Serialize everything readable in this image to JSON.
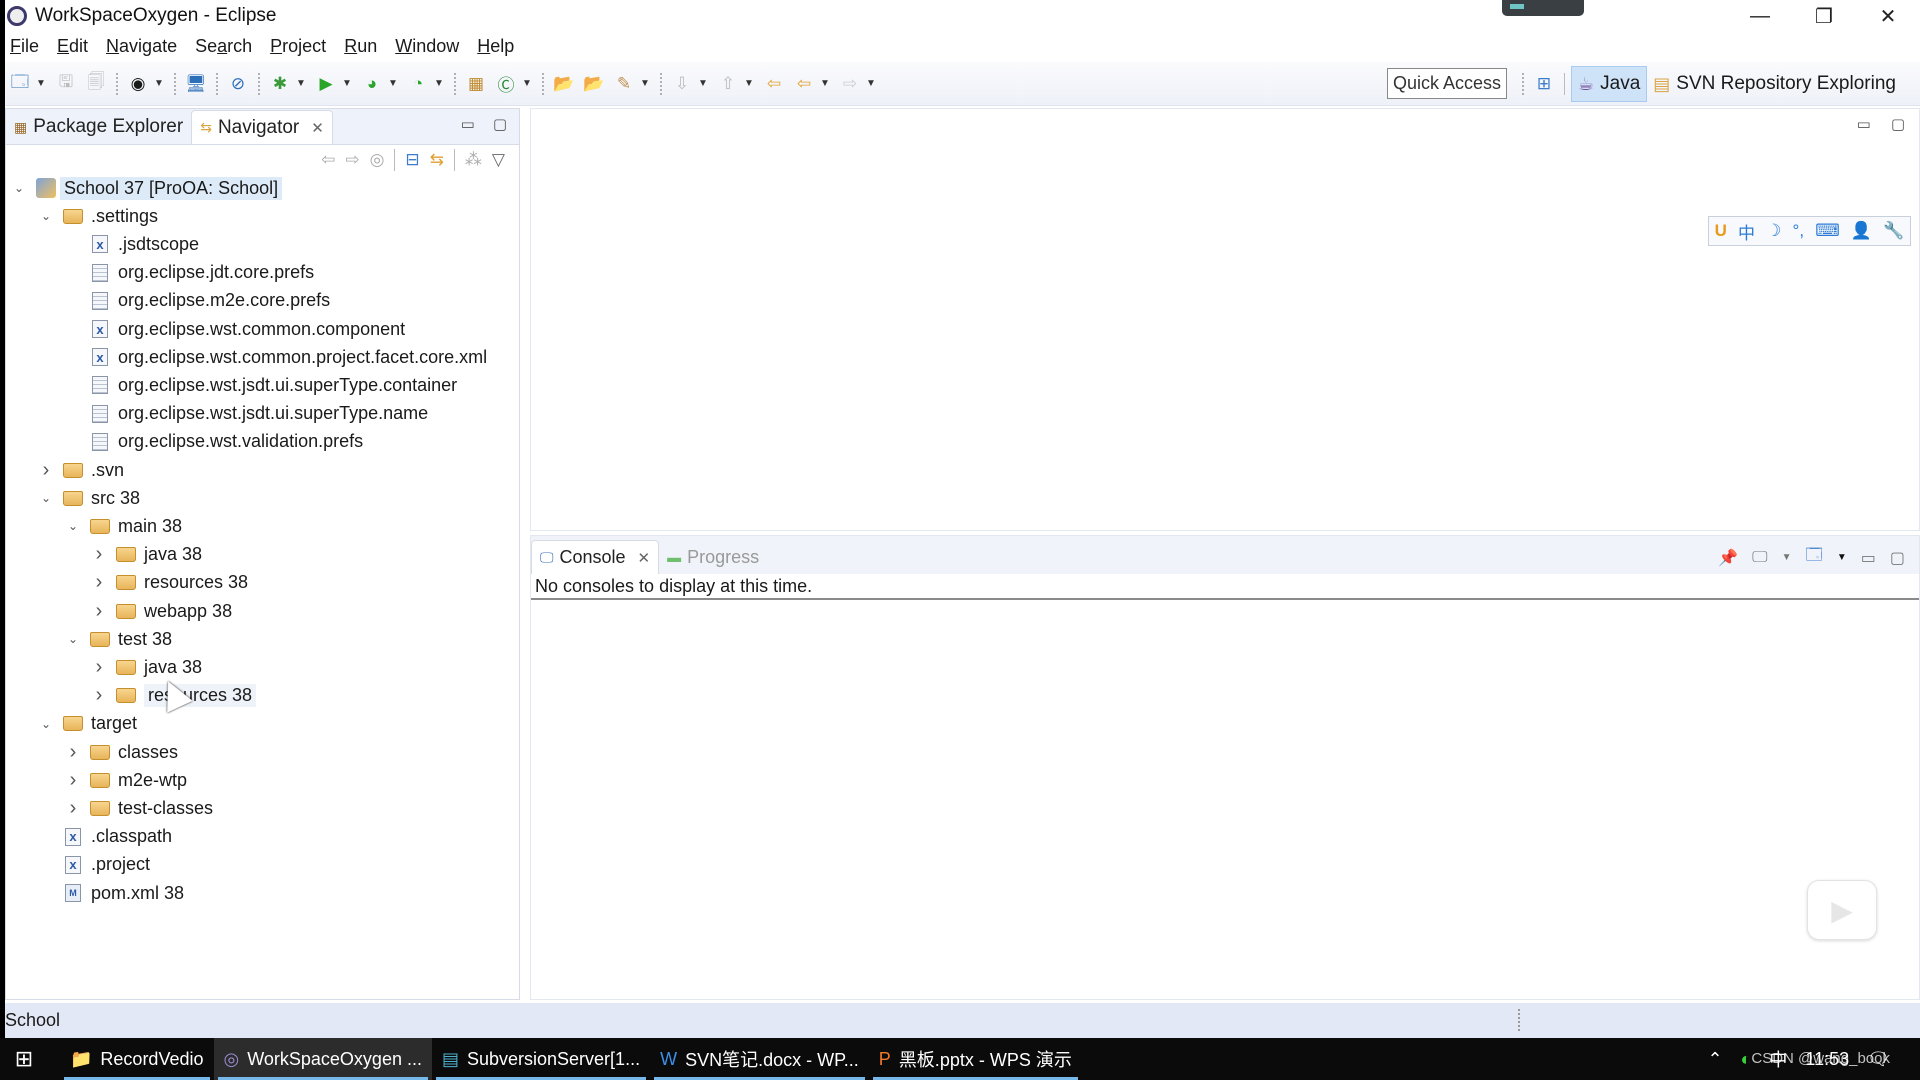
{
  "window": {
    "title": "WorkSpaceOxygen - Eclipse",
    "controls": [
      "minimize",
      "restore",
      "close"
    ]
  },
  "menu": [
    {
      "label": "File",
      "mnemonic": "F"
    },
    {
      "label": "Edit",
      "mnemonic": "E"
    },
    {
      "label": "Navigate",
      "mnemonic": "N"
    },
    {
      "label": "Search",
      "mnemonic": "a"
    },
    {
      "label": "Project",
      "mnemonic": "P"
    },
    {
      "label": "Run",
      "mnemonic": "R"
    },
    {
      "label": "Window",
      "mnemonic": "W"
    },
    {
      "label": "Help",
      "mnemonic": "H"
    }
  ],
  "toolbar": {
    "quick_access": "Quick Access",
    "perspectives": [
      {
        "label": "Java",
        "active": true
      },
      {
        "label": "SVN Repository Exploring",
        "active": false
      }
    ]
  },
  "left_panel": {
    "tabs": [
      {
        "label": "Package Explorer",
        "active": false
      },
      {
        "label": "Navigator",
        "active": true
      }
    ],
    "tree": [
      {
        "label": "School 37 [ProOA: School]",
        "depth": 0,
        "type": "project",
        "expand": "open",
        "selected": true
      },
      {
        "label": ".settings",
        "depth": 1,
        "type": "folder",
        "expand": "open"
      },
      {
        "label": ".jsdtscope",
        "depth": 2,
        "type": "xml",
        "expand": "none"
      },
      {
        "label": "org.eclipse.jdt.core.prefs",
        "depth": 2,
        "type": "txt",
        "expand": "none"
      },
      {
        "label": "org.eclipse.m2e.core.prefs",
        "depth": 2,
        "type": "txt",
        "expand": "none"
      },
      {
        "label": "org.eclipse.wst.common.component",
        "depth": 2,
        "type": "xml",
        "expand": "none"
      },
      {
        "label": "org.eclipse.wst.common.project.facet.core.xml",
        "depth": 2,
        "type": "xml",
        "expand": "none"
      },
      {
        "label": "org.eclipse.wst.jsdt.ui.superType.container",
        "depth": 2,
        "type": "txt",
        "expand": "none"
      },
      {
        "label": "org.eclipse.wst.jsdt.ui.superType.name",
        "depth": 2,
        "type": "txt",
        "expand": "none"
      },
      {
        "label": "org.eclipse.wst.validation.prefs",
        "depth": 2,
        "type": "txt",
        "expand": "none"
      },
      {
        "label": ".svn",
        "depth": 1,
        "type": "folder",
        "expand": "closed"
      },
      {
        "label": "src 38",
        "depth": 1,
        "type": "folder",
        "expand": "open"
      },
      {
        "label": "main 38",
        "depth": 2,
        "type": "folder",
        "expand": "open"
      },
      {
        "label": "java 38",
        "depth": 3,
        "type": "folder",
        "expand": "closed"
      },
      {
        "label": "resources 38",
        "depth": 3,
        "type": "folder",
        "expand": "closed"
      },
      {
        "label": "webapp 38",
        "depth": 3,
        "type": "folder",
        "expand": "closed"
      },
      {
        "label": "test 38",
        "depth": 2,
        "type": "folder",
        "expand": "open"
      },
      {
        "label": "java 38",
        "depth": 3,
        "type": "folder",
        "expand": "closed"
      },
      {
        "label": "resources 38",
        "depth": 3,
        "type": "folder",
        "expand": "closed",
        "hover": true
      },
      {
        "label": "target",
        "depth": 1,
        "type": "folder",
        "expand": "open"
      },
      {
        "label": "classes",
        "depth": 2,
        "type": "folder",
        "expand": "closed"
      },
      {
        "label": "m2e-wtp",
        "depth": 2,
        "type": "folder",
        "expand": "closed"
      },
      {
        "label": "test-classes",
        "depth": 2,
        "type": "folder",
        "expand": "closed"
      },
      {
        "label": ".classpath",
        "depth": 1,
        "type": "xml",
        "expand": "none"
      },
      {
        "label": ".project",
        "depth": 1,
        "type": "xml",
        "expand": "none"
      },
      {
        "label": "pom.xml 38",
        "depth": 1,
        "type": "pom",
        "expand": "none"
      }
    ]
  },
  "ime_bar": [
    "U",
    "中",
    "☽",
    "°,",
    "⌨",
    "👤",
    "🔧"
  ],
  "console": {
    "tabs": [
      {
        "label": "Console",
        "active": true
      },
      {
        "label": "Progress",
        "active": false
      }
    ],
    "message": "No consoles to display at this time."
  },
  "status": {
    "text": "School"
  },
  "taskbar": {
    "items": [
      {
        "label": "RecordVedio",
        "icon": "folder-icon",
        "active": false
      },
      {
        "label": "WorkSpaceOxygen ...",
        "icon": "eclipse-icon",
        "active": true
      },
      {
        "label": "SubversionServer[1...",
        "icon": "svn-server-icon",
        "active": false
      },
      {
        "label": "SVN笔记.docx - WP...",
        "icon": "wps-writer-icon",
        "active": false
      },
      {
        "label": "黑板.pptx - WPS 演示",
        "icon": "wps-presentation-icon",
        "active": false
      }
    ],
    "ime": "中",
    "clock": "11:53",
    "watermark": "CSDN @wang_book"
  }
}
